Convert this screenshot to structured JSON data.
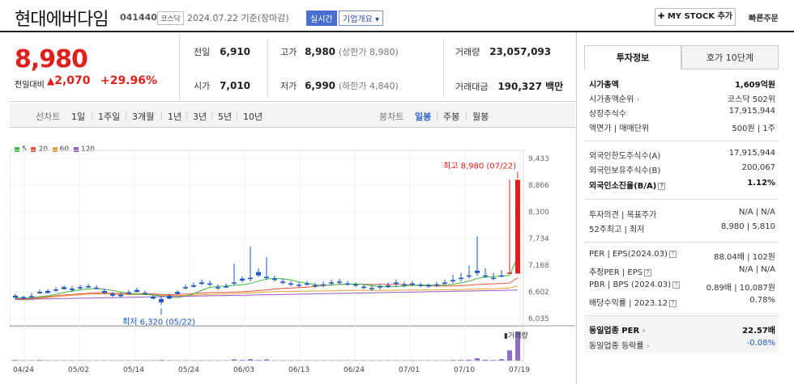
{
  "header": {
    "stock_name": "현대에버다임",
    "stock_code": "041440",
    "market": "코스닥",
    "date": "2024.07.22 기준(장마감)",
    "realtime": "실시간",
    "company_info": "기업개요",
    "mystock": "✚ MY STOCK 추가",
    "quick_order": "빠른주문"
  },
  "summary": {
    "price": "8,980",
    "change_label": "전일대비",
    "change_amount": "2,070",
    "change_pct": "+29.96%",
    "prev_label": "전일",
    "prev_value": "6,910",
    "open_label": "시가",
    "open_value": "7,010",
    "high_label": "고가",
    "high_value": "8,980",
    "high_note": "(상한가 8,980)",
    "low_label": "저가",
    "low_value": "6,990",
    "low_note": "(하한가 4,840)",
    "volume_label": "거래량",
    "volume_value": "23,057,093",
    "amount_label": "거래대금",
    "amount_value": "190,327 백만"
  },
  "tabs": {
    "line_label": "선차트",
    "line_items": [
      "1일",
      "1주일",
      "3개월",
      "1년",
      "3년",
      "5년",
      "10년"
    ],
    "candle_label": "봉차트",
    "candle_items": [
      "일봉",
      "주봉",
      "월봉"
    ],
    "active_candle": "일봉"
  },
  "colors": {
    "up": "#e0201c",
    "down": "#1a56c5",
    "ma5": "#3fb83f",
    "ma20": "#e8543a",
    "ma60": "#e8a037",
    "ma120": "#9b59c7",
    "volume": "#8e6fc8"
  },
  "chart_data": {
    "type": "candlestick",
    "legend": [
      "5",
      "20",
      "60",
      "120"
    ],
    "ylim": [
      6035,
      9433
    ],
    "yticks": [
      "9,433",
      "8,866",
      "8,300",
      "7,734",
      "7,168",
      "6,602",
      "6,035"
    ],
    "xticks": [
      "04/24",
      "05/02",
      "05/14",
      "05/24",
      "06/03",
      "06/13",
      "06/24",
      "07/01",
      "07/10",
      "07/19"
    ],
    "annotations": {
      "high": "최고 8,980 (07/22)",
      "low": "최저 6,320 (05/22)"
    },
    "volume_label": "거래량",
    "candles": [
      [
        6520,
        6560,
        6480,
        6440
      ],
      [
        6490,
        6520,
        6460,
        6450
      ],
      [
        6510,
        6580,
        6490,
        6470
      ],
      [
        6600,
        6650,
        6570,
        6560
      ],
      [
        6620,
        6660,
        6580,
        6570
      ],
      [
        6650,
        6700,
        6640,
        6600
      ],
      [
        6700,
        6740,
        6660,
        6650
      ],
      [
        6670,
        6720,
        6640,
        6600
      ],
      [
        6700,
        6750,
        6690,
        6650
      ],
      [
        6720,
        6770,
        6700,
        6680
      ],
      [
        6690,
        6740,
        6670,
        6650
      ],
      [
        6620,
        6670,
        6580,
        6560
      ],
      [
        6560,
        6600,
        6520,
        6490
      ],
      [
        6540,
        6580,
        6510,
        6480
      ],
      [
        6590,
        6640,
        6560,
        6540
      ],
      [
        6640,
        6690,
        6600,
        6590
      ],
      [
        6580,
        6630,
        6550,
        6540
      ],
      [
        6500,
        6540,
        6460,
        6440
      ],
      [
        6450,
        6500,
        6380,
        6320
      ],
      [
        6520,
        6560,
        6460,
        6440
      ],
      [
        6600,
        6640,
        6560,
        6540
      ],
      [
        6700,
        6760,
        6680,
        6650
      ],
      [
        6740,
        6800,
        6710,
        6690
      ],
      [
        6800,
        6860,
        6770,
        6740
      ],
      [
        6780,
        6840,
        6760,
        6720
      ],
      [
        6700,
        6760,
        6680,
        6640
      ],
      [
        6720,
        6780,
        6700,
        6680
      ],
      [
        6800,
        7200,
        6780,
        6740
      ],
      [
        6880,
        6930,
        6840,
        6800
      ],
      [
        6900,
        7560,
        6880,
        6820
      ],
      [
        7020,
        7100,
        6950,
        6920
      ],
      [
        6920,
        7340,
        6900,
        6860
      ],
      [
        6880,
        6950,
        6860,
        6820
      ],
      [
        6820,
        6880,
        6800,
        6760
      ],
      [
        6780,
        6830,
        6760,
        6720
      ],
      [
        6750,
        6800,
        6730,
        6700
      ],
      [
        6780,
        6830,
        6760,
        6730
      ],
      [
        6740,
        6790,
        6720,
        6690
      ],
      [
        6760,
        6820,
        6740,
        6700
      ],
      [
        6800,
        6860,
        6780,
        6740
      ],
      [
        6820,
        6880,
        6800,
        6760
      ],
      [
        6780,
        6830,
        6770,
        6730
      ],
      [
        6760,
        6800,
        6740,
        6700
      ],
      [
        6710,
        6760,
        6700,
        6660
      ],
      [
        6680,
        6740,
        6670,
        6630
      ],
      [
        6720,
        6780,
        6700,
        6650
      ],
      [
        6740,
        6800,
        6720,
        6680
      ],
      [
        6800,
        6860,
        6780,
        6700
      ],
      [
        6760,
        6820,
        6740,
        6700
      ],
      [
        6780,
        6830,
        6760,
        6720
      ],
      [
        6750,
        6800,
        6740,
        6700
      ],
      [
        6740,
        6780,
        6720,
        6690
      ],
      [
        6760,
        6820,
        6740,
        6700
      ],
      [
        6800,
        6860,
        6780,
        6740
      ],
      [
        6850,
        6960,
        6830,
        6780
      ],
      [
        6900,
        7000,
        6880,
        6820
      ],
      [
        6950,
        7160,
        6930,
        6880
      ],
      [
        7050,
        7780,
        7000,
        6940
      ],
      [
        6950,
        7100,
        6930,
        6900
      ],
      [
        6900,
        7000,
        6880,
        6850
      ],
      [
        6950,
        7060,
        6940,
        6910
      ],
      [
        7010,
        8980,
        7010,
        6990
      ],
      [
        6990,
        8980,
        8980,
        6990
      ]
    ],
    "volume": [
      2,
      1,
      1,
      2,
      1,
      1,
      1,
      1,
      1,
      1,
      1,
      1,
      1,
      1,
      1,
      1,
      1,
      1,
      2,
      1,
      1,
      1,
      1,
      1,
      1,
      1,
      1,
      4,
      2,
      5,
      2,
      4,
      1,
      1,
      1,
      1,
      1,
      1,
      1,
      1,
      1,
      1,
      1,
      1,
      1,
      1,
      1,
      1,
      1,
      1,
      1,
      1,
      1,
      1,
      2,
      2,
      3,
      8,
      3,
      2,
      5,
      35,
      100
    ]
  },
  "invest_panel": {
    "tab_active": "투자정보",
    "tab_other": "호가 10단계",
    "market_cap_label": "시가총액",
    "market_cap_value": "1,609억원",
    "rank_label": "시가총액순위",
    "rank_value": "코스닥 502위",
    "shares_label": "상장주식수",
    "shares_value": "17,915,944",
    "face_label": "액면가 | 매매단위",
    "face_value": "500원 | 1주",
    "foreign_limit_label": "외국인한도주식수(A)",
    "foreign_limit_value": "17,915,944",
    "foreign_hold_label": "외국인보유주식수(B)",
    "foreign_hold_value": "200,067",
    "foreign_ratio_label": "외국인소진율(B/A)",
    "foreign_ratio_value": "1.12%",
    "opinion_label": "투자의견 | 목표주가",
    "opinion_value": "N/A | N/A",
    "week52_label": "52주최고 | 최저",
    "week52_value": "8,980 | 5,810",
    "per_label": "PER | EPS(2024.03)",
    "per_value": "88.04배 | 102원",
    "est_per_label": "추정PER | EPS",
    "est_per_value": "N/A | N/A",
    "pbr_label": "PBR | BPS (2024.03)",
    "pbr_value": "0.89배 | 10,087원",
    "dividend_label": "배당수익률 | 2023.12",
    "dividend_value": "0.78%",
    "industry_per_label": "동일업종 PER",
    "industry_per_value": "22.57배",
    "industry_chg_label": "동일업종 등락률",
    "industry_chg_value": "-0.08%"
  }
}
